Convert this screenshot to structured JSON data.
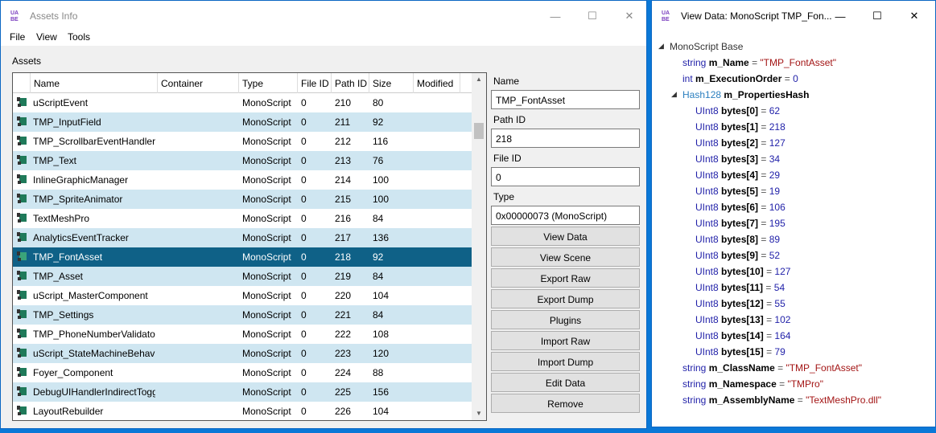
{
  "main_window": {
    "title": "Assets Info",
    "min_glyph": "—",
    "max_glyph": "☐",
    "close_glyph": "✕",
    "menu": [
      "File",
      "View",
      "Tools"
    ]
  },
  "assets": {
    "label": "Assets",
    "columns": [
      "Name",
      "Container",
      "Type",
      "File ID",
      "Path ID",
      "Size",
      "Modified"
    ],
    "rows": [
      {
        "name": "uScriptEvent",
        "type": "MonoScript",
        "file_id": "0",
        "path_id": "210",
        "size": "80"
      },
      {
        "name": "TMP_InputField",
        "type": "MonoScript",
        "file_id": "0",
        "path_id": "211",
        "size": "92"
      },
      {
        "name": "TMP_ScrollbarEventHandler",
        "type": "MonoScript",
        "file_id": "0",
        "path_id": "212",
        "size": "116"
      },
      {
        "name": "TMP_Text",
        "type": "MonoScript",
        "file_id": "0",
        "path_id": "213",
        "size": "76"
      },
      {
        "name": "InlineGraphicManager",
        "type": "MonoScript",
        "file_id": "0",
        "path_id": "214",
        "size": "100"
      },
      {
        "name": "TMP_SpriteAnimator",
        "type": "MonoScript",
        "file_id": "0",
        "path_id": "215",
        "size": "100"
      },
      {
        "name": "TextMeshPro",
        "type": "MonoScript",
        "file_id": "0",
        "path_id": "216",
        "size": "84"
      },
      {
        "name": "AnalyticsEventTracker",
        "type": "MonoScript",
        "file_id": "0",
        "path_id": "217",
        "size": "136"
      },
      {
        "name": "TMP_FontAsset",
        "type": "MonoScript",
        "file_id": "0",
        "path_id": "218",
        "size": "92"
      },
      {
        "name": "TMP_Asset",
        "type": "MonoScript",
        "file_id": "0",
        "path_id": "219",
        "size": "84"
      },
      {
        "name": "uScript_MasterComponent",
        "type": "MonoScript",
        "file_id": "0",
        "path_id": "220",
        "size": "104"
      },
      {
        "name": "TMP_Settings",
        "type": "MonoScript",
        "file_id": "0",
        "path_id": "221",
        "size": "84"
      },
      {
        "name": "TMP_PhoneNumberValidator",
        "type": "MonoScript",
        "file_id": "0",
        "path_id": "222",
        "size": "108"
      },
      {
        "name": "uScript_StateMachineBehavio",
        "type": "MonoScript",
        "file_id": "0",
        "path_id": "223",
        "size": "120"
      },
      {
        "name": "Foyer_Component",
        "type": "MonoScript",
        "file_id": "0",
        "path_id": "224",
        "size": "88"
      },
      {
        "name": "DebugUIHandlerIndirectToggl",
        "type": "MonoScript",
        "file_id": "0",
        "path_id": "225",
        "size": "156"
      },
      {
        "name": "LayoutRebuilder",
        "type": "MonoScript",
        "file_id": "0",
        "path_id": "226",
        "size": "104"
      }
    ],
    "selected_index": 8
  },
  "details": {
    "name_label": "Name",
    "name_value": "TMP_FontAsset",
    "path_id_label": "Path ID",
    "path_id_value": "218",
    "file_id_label": "File ID",
    "file_id_value": "0",
    "type_label": "Type",
    "type_value": "0x00000073 (MonoScript)"
  },
  "buttons": [
    "View Data",
    "View Scene",
    "Export Raw",
    "Export Dump",
    "Plugins",
    "Import Raw",
    "Import Dump",
    "Edit Data",
    "Remove"
  ],
  "view_window": {
    "title": "View Data: MonoScript TMP_Fon...",
    "min_glyph": "—",
    "max_glyph": "☐",
    "close_glyph": "✕",
    "root": "MonoScript Base",
    "m_name": {
      "type": "string",
      "field": "m_Name",
      "value": "\"TMP_FontAsset\""
    },
    "exec_order": {
      "type": "int",
      "field": "m_ExecutionOrder",
      "value": "0"
    },
    "hash": {
      "type": "Hash128",
      "field": "m_PropertiesHash"
    },
    "bytes": [
      {
        "label": "bytes[0]",
        "value": "62"
      },
      {
        "label": "bytes[1]",
        "value": "218"
      },
      {
        "label": "bytes[2]",
        "value": "127"
      },
      {
        "label": "bytes[3]",
        "value": "34"
      },
      {
        "label": "bytes[4]",
        "value": "29"
      },
      {
        "label": "bytes[5]",
        "value": "19"
      },
      {
        "label": "bytes[6]",
        "value": "106"
      },
      {
        "label": "bytes[7]",
        "value": "195"
      },
      {
        "label": "bytes[8]",
        "value": "89"
      },
      {
        "label": "bytes[9]",
        "value": "52"
      },
      {
        "label": "bytes[10]",
        "value": "127"
      },
      {
        "label": "bytes[11]",
        "value": "54"
      },
      {
        "label": "bytes[12]",
        "value": "55"
      },
      {
        "label": "bytes[13]",
        "value": "102"
      },
      {
        "label": "bytes[14]",
        "value": "164"
      },
      {
        "label": "bytes[15]",
        "value": "79"
      }
    ],
    "byte_type": "UInt8",
    "class_name": {
      "type": "string",
      "field": "m_ClassName",
      "value": "\"TMP_FontAsset\""
    },
    "namespace": {
      "type": "string",
      "field": "m_Namespace",
      "value": "\"TMPro\""
    },
    "assembly": {
      "type": "string",
      "field": "m_AssemblyName",
      "value": "\"TextMeshPro.dll\""
    }
  },
  "icons": {
    "app": "uabe-logo",
    "row": "script-asset-icon"
  },
  "colors": {
    "selected_row": "#0f6187",
    "alt_row": "#cfe6f1",
    "desktop": "#0a78d7"
  }
}
